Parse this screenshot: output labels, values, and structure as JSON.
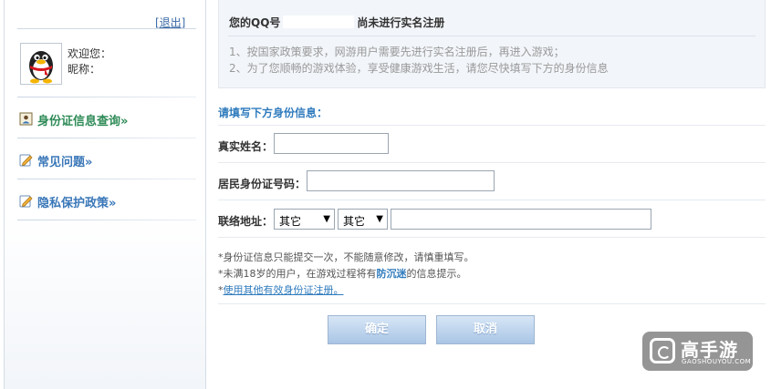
{
  "sidebar": {
    "logout": "[退出]",
    "welcome": "欢迎您：",
    "nickname": "昵称：",
    "links": [
      {
        "label": "身份证信息查询»",
        "icon": "id-card-icon"
      },
      {
        "label": "常见问题»",
        "icon": "pencil-note-icon"
      },
      {
        "label": "隐私保护政策»",
        "icon": "pencil-note-icon"
      }
    ]
  },
  "notice": {
    "title_prefix": "您的QQ号",
    "title_suffix": "尚未进行实名注册",
    "lines": [
      "1、按国家政策要求，网游用户需要先进行实名注册后，再进入游戏；",
      "2、为了您顺畅的游戏体验，享受健康游戏生活，请您尽快填写下方的身份信息"
    ]
  },
  "form": {
    "title": "请填写下方身份信息：",
    "name_label": "真实姓名：",
    "id_label": "居民身份证号码：",
    "address_label": "联络地址：",
    "province": "其它",
    "city": "其它",
    "arrow": "▼"
  },
  "notes": {
    "line1": "*身份证信息只能提交一次，不能随意修改，请慎重填写。",
    "line2_prefix": "*未满18岁的用户，在游戏过程将有",
    "line2_bold": "防沉迷",
    "line2_suffix": "的信息提示。",
    "line3_star": "*",
    "line3_link": "使用其他有效身份证注册。"
  },
  "buttons": {
    "ok": "确定",
    "cancel": "取消"
  },
  "watermark": {
    "text": "高手游",
    "sub": "GAOSHOUYOU.COM"
  },
  "colors": {
    "accent": "#2f7bbd",
    "link": "#3a77b8",
    "notice_bg": "#f2f5f9"
  }
}
